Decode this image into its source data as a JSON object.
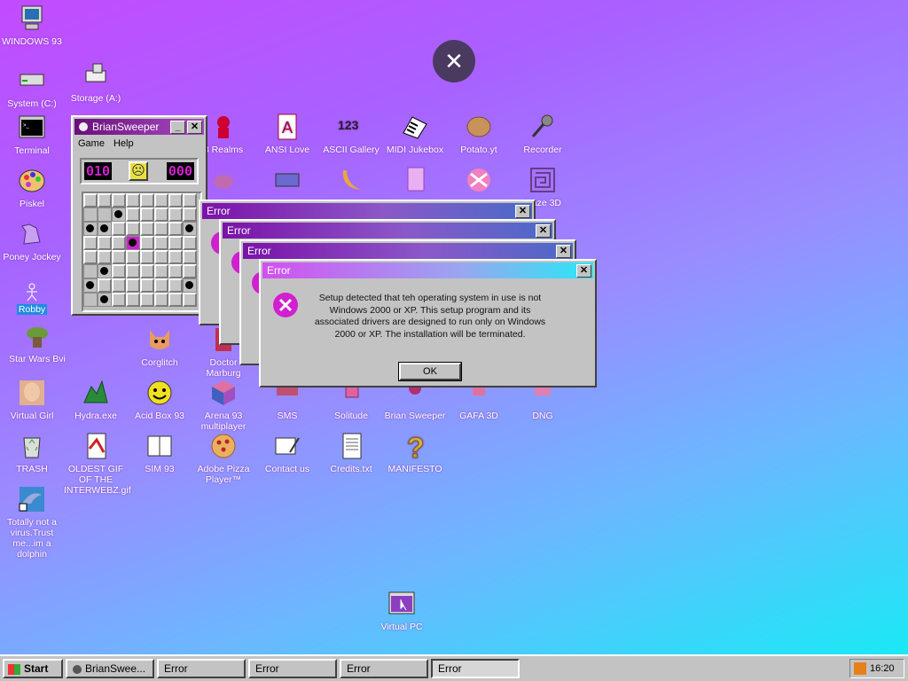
{
  "desktop": {
    "icons": {
      "windows93": "WINDOWS 93",
      "system": "System (C:)",
      "storage": "Storage (A:)",
      "terminal": "Terminal",
      "piskel": "Piskel",
      "poney": "Poney Jockey",
      "robby": "Robby",
      "starwars": "Star Wars Bvi",
      "virtualgirl": "Virtual Girl",
      "trash": "TRASH",
      "dolphin": "Totally not a virus.Trust me...im a dolphin",
      "realms": "3 Realms",
      "ansilove": "ANSI Love",
      "ascii": "ASCII Gallery",
      "midi": "MIDI Jukebox",
      "potato": "Potato.yt",
      "recorder": "Recorder",
      "maze": "Maze 3D",
      "corglitch": "Corglitch",
      "doctor": "Doctor Marburg",
      "hydra": "Hydra.exe",
      "acidbox": "Acid Box 93",
      "arena": "Arena 93 multiplayer",
      "sms": "SMS",
      "solitude": "Solitude",
      "briansweeper": "Brian Sweeper",
      "gafa": "GAFA 3D",
      "dng": "DNG",
      "oldestgif": "OLDEST GIF OF THE INTERWEBZ.gif",
      "sim93": "SIM 93",
      "pizza": "Adobe Pizza Player™",
      "contact": "Contact us",
      "credits": "Credits.txt",
      "manifesto": "MANIFESTO",
      "virtualpc": "Virtual PC"
    },
    "close_glyph": "✕"
  },
  "briansweeper": {
    "title": "BrianSweeper",
    "menu_game": "Game",
    "menu_help": "Help",
    "mines_left": "010",
    "timer": "000",
    "face": "☹"
  },
  "error_windows": {
    "title": "Error",
    "message": "Setup detected that teh operating system in use is not Windows 2000 or XP. This setup program and its associated drivers are designed to run only on Windows 2000 or XP. The installation will be terminated.",
    "ok_label": "OK"
  },
  "taskbar": {
    "start_label": "Start",
    "items": [
      "BrianSwee...",
      "Error",
      "Error",
      "Error",
      "Error"
    ],
    "clock": "16:20"
  },
  "colors": {
    "titlebar_dark": "#6a0f7a",
    "titlebar_active_end": "#27e8f8",
    "error_icon": "#d020d0"
  }
}
